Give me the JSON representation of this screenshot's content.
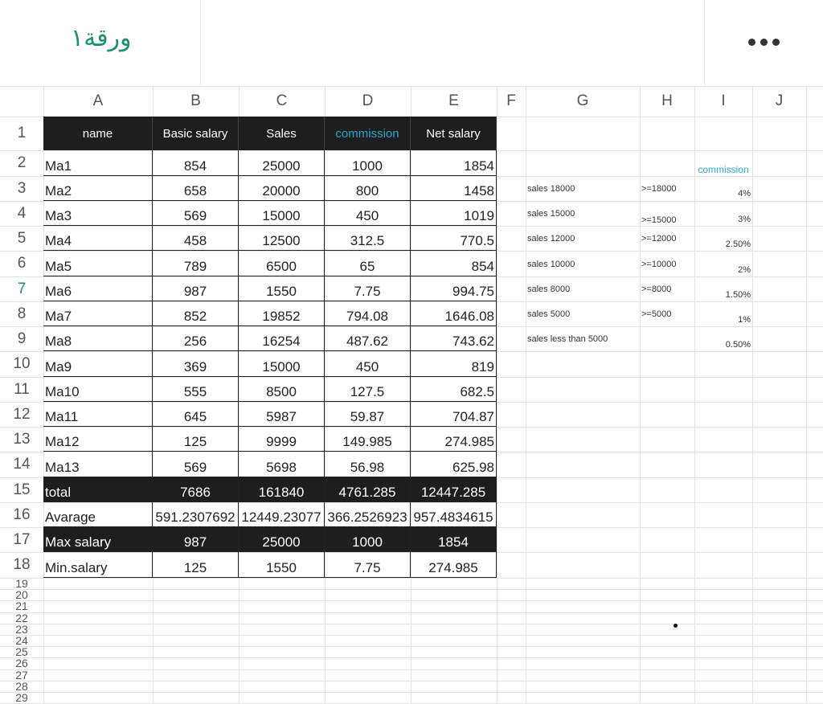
{
  "header": {
    "sheet_title": "ورقة١"
  },
  "columns": [
    "A",
    "B",
    "C",
    "D",
    "E",
    "F",
    "G",
    "H",
    "I",
    "J"
  ],
  "row_numbers": [
    "1",
    "2",
    "3",
    "4",
    "5",
    "6",
    "7",
    "8",
    "9",
    "10",
    "11",
    "12",
    "13",
    "14",
    "15",
    "16",
    "17",
    "18",
    "19",
    "20",
    "21",
    "22",
    "23",
    "24",
    "25",
    "26",
    "27",
    "28",
    "29"
  ],
  "active_row": "7",
  "table": {
    "headers": [
      "name",
      "Basic salary",
      "Sales",
      "commission",
      "Net salary"
    ],
    "rows": [
      [
        "Ma1",
        "854",
        "25000",
        "1000",
        "1854"
      ],
      [
        "Ma2",
        "658",
        "20000",
        "800",
        "1458"
      ],
      [
        "Ma3",
        "569",
        "15000",
        "450",
        "1019"
      ],
      [
        "Ma4",
        "458",
        "12500",
        "312.5",
        "770.5"
      ],
      [
        "Ma5",
        "789",
        "6500",
        "65",
        "854"
      ],
      [
        "Ma6",
        "987",
        "1550",
        "7.75",
        "994.75"
      ],
      [
        "Ma7",
        "852",
        "19852",
        "794.08",
        "1646.08"
      ],
      [
        "Ma8",
        "256",
        "16254",
        "487.62",
        "743.62"
      ],
      [
        "Ma9",
        "369",
        "15000",
        "450",
        "819"
      ],
      [
        "Ma10",
        "555",
        "8500",
        "127.5",
        "682.5"
      ],
      [
        "Ma11",
        "645",
        "5987",
        "59.87",
        "704.87"
      ],
      [
        "Ma12",
        "125",
        "9999",
        "149.985",
        "274.985"
      ],
      [
        "Ma13",
        "569",
        "5698",
        "56.98",
        "625.98"
      ]
    ],
    "summary": [
      [
        "total",
        "7686",
        "161840",
        "4761.285",
        "12447.285"
      ],
      [
        "Avarage",
        "591.2307692",
        "12449.23077",
        "366.2526923",
        "957.4834615"
      ],
      [
        "Max salary",
        "987",
        "25000",
        "1000",
        "1854"
      ],
      [
        "Min.salary",
        "125",
        "1550",
        "7.75",
        "274.985"
      ]
    ]
  },
  "commission_rules": {
    "header": "commission",
    "rows": [
      {
        "label": "sales 18000",
        "cond": ">=18000",
        "rate": "4%"
      },
      {
        "label": "sales 15000",
        "cond": ">=15000",
        "rate": "3%"
      },
      {
        "label": "sales 12000",
        "cond": ">=12000",
        "rate": "2.50%"
      },
      {
        "label": "sales 10000",
        "cond": ">=10000",
        "rate": "2%"
      },
      {
        "label": "sales 8000",
        "cond": ">=8000",
        "rate": "1.50%"
      },
      {
        "label": "sales 5000",
        "cond": ">=5000",
        "rate": "1%"
      },
      {
        "label": "sales less than 5000",
        "cond": "",
        "rate": "0.50%"
      }
    ]
  },
  "colors": {
    "accent": "#1b9070",
    "header_fill": "#1e1e1e",
    "commission_text": "#2aa6d5"
  }
}
